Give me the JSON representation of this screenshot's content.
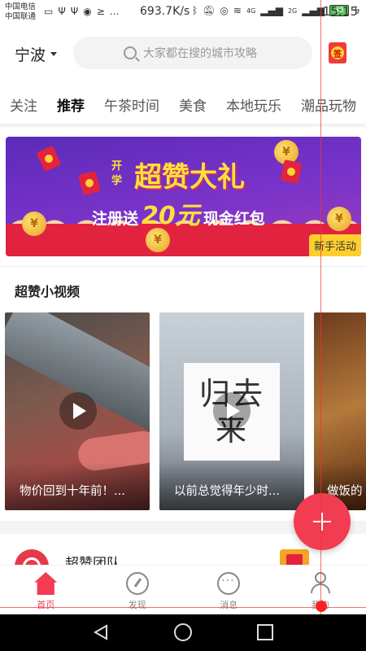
{
  "status_bar": {
    "carrier_1": "中国电信",
    "carrier_2": "中国联通",
    "net_speed": "693.7K/s",
    "signal_1": "4G",
    "signal_2": "2G",
    "battery": "38",
    "time": "15:15"
  },
  "header": {
    "city": "宁波",
    "search_placeholder": "大家都在搜的城市攻略",
    "sign_label": "签"
  },
  "tabs": [
    {
      "label": "关注"
    },
    {
      "label": "推荐"
    },
    {
      "label": "午茶时间"
    },
    {
      "label": "美食"
    },
    {
      "label": "本地玩乐"
    },
    {
      "label": "潮品玩物"
    }
  ],
  "banner": {
    "title": "超赞大礼",
    "kaixue": "开学",
    "register_text": "注册送",
    "amount": "20元",
    "tagline": "现金红包",
    "badge": "新手活动"
  },
  "section": {
    "videos_title": "超赞小视频"
  },
  "videos": [
    {
      "caption": "物价回到十年前！..."
    },
    {
      "caption": "以前总觉得年少时...",
      "card_line_1": "归去",
      "card_line_2": "来"
    },
    {
      "caption": "做饭的"
    }
  ],
  "team": {
    "name": "超赞团队"
  },
  "bottom_nav": [
    {
      "label": "首页",
      "icon": "home-icon"
    },
    {
      "label": "发现",
      "icon": "discover-icon"
    },
    {
      "label": "消息",
      "icon": "message-icon"
    },
    {
      "label": "我的",
      "icon": "profile-icon"
    }
  ],
  "colors": {
    "accent": "#f23c52",
    "banner_purple": "#6a2fc0",
    "banner_yellow": "#ffe03a"
  }
}
